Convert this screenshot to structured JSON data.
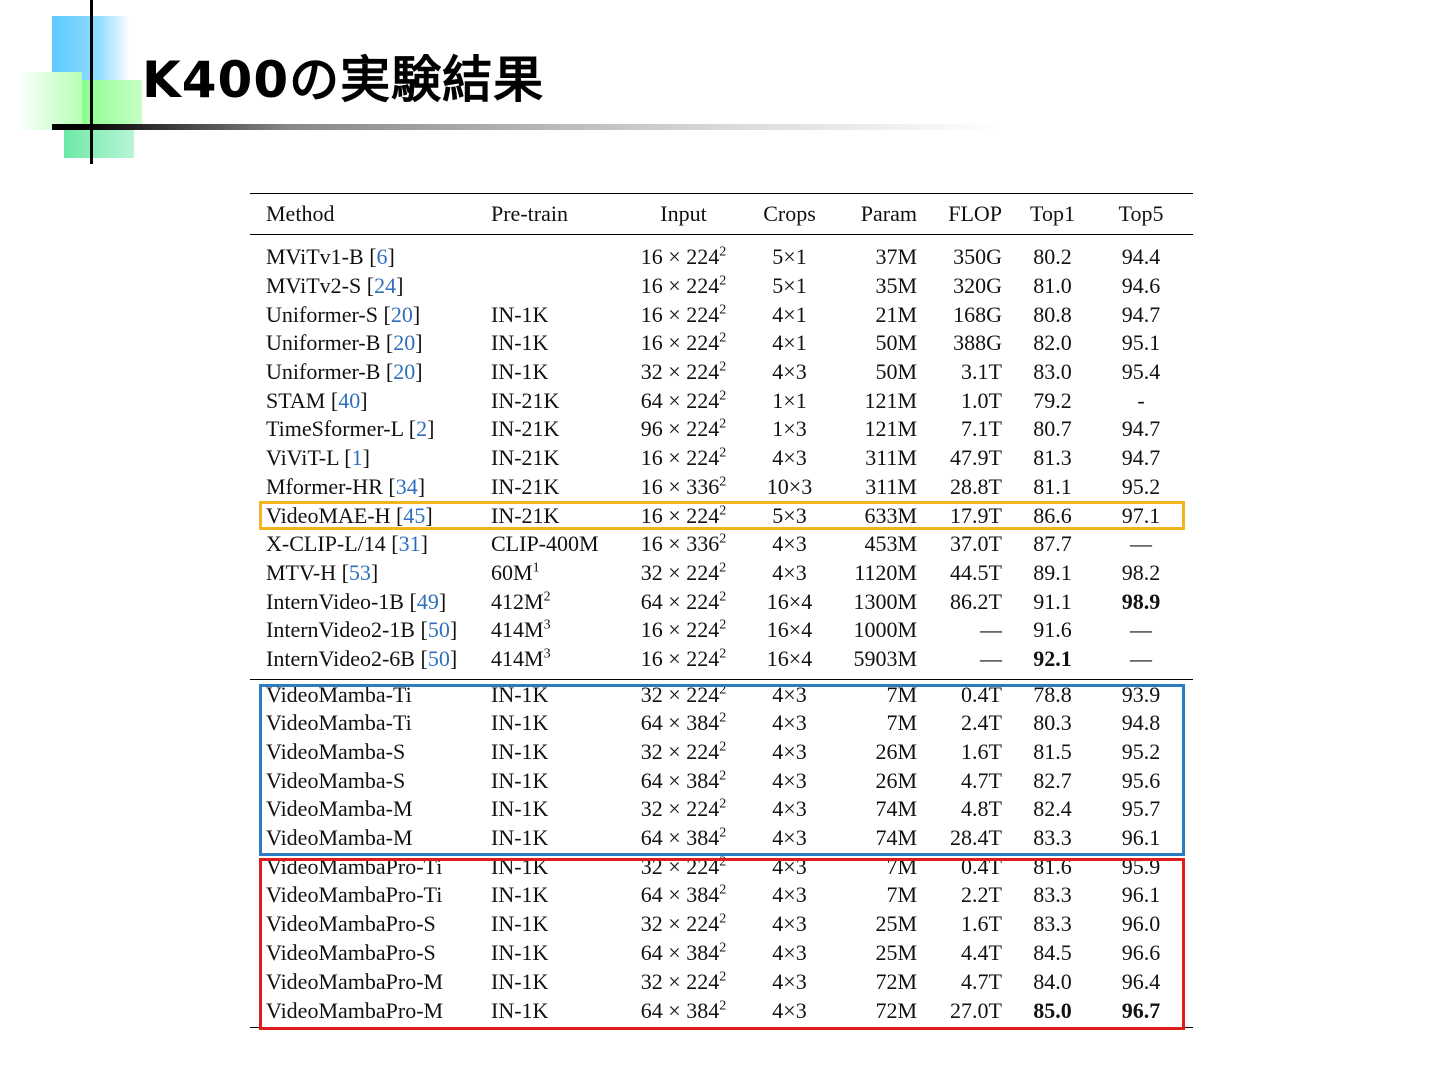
{
  "slide": {
    "title": "K400の実験結果"
  },
  "colors": {
    "highlight_yellow": "#f5b320",
    "highlight_blue": "#2b7cc0",
    "highlight_red": "#e01b1b",
    "ref_blue": "#2f6fbd"
  },
  "table": {
    "headers": {
      "method": "Method",
      "pretrain": "Pre-train",
      "input": "Input",
      "crops": "Crops",
      "param": "Param",
      "flop": "FLOP",
      "top1": "Top1",
      "top5": "Top5"
    },
    "rows": [
      {
        "name": "MViTv1-B",
        "ref": "6",
        "pretrain": "",
        "pt_sup": "",
        "frames": "16",
        "res": "224",
        "crops": "5×1",
        "param": "37M",
        "flop": "350G",
        "top1": "80.2",
        "top5": "94.4"
      },
      {
        "name": "MViTv2-S",
        "ref": "24",
        "pretrain": "",
        "pt_sup": "",
        "frames": "16",
        "res": "224",
        "crops": "5×1",
        "param": "35M",
        "flop": "320G",
        "top1": "81.0",
        "top5": "94.6"
      },
      {
        "name": "Uniformer-S",
        "ref": "20",
        "pretrain": "IN-1K",
        "pt_sup": "",
        "frames": "16",
        "res": "224",
        "crops": "4×1",
        "param": "21M",
        "flop": "168G",
        "top1": "80.8",
        "top5": "94.7"
      },
      {
        "name": "Uniformer-B",
        "ref": "20",
        "pretrain": "IN-1K",
        "pt_sup": "",
        "frames": "16",
        "res": "224",
        "crops": "4×1",
        "param": "50M",
        "flop": "388G",
        "top1": "82.0",
        "top5": "95.1"
      },
      {
        "name": "Uniformer-B",
        "ref": "20",
        "pretrain": "IN-1K",
        "pt_sup": "",
        "frames": "32",
        "res": "224",
        "crops": "4×3",
        "param": "50M",
        "flop": "3.1T",
        "top1": "83.0",
        "top5": "95.4"
      },
      {
        "name": "STAM",
        "ref": "40",
        "pretrain": "IN-21K",
        "pt_sup": "",
        "frames": "64",
        "res": "224",
        "crops": "1×1",
        "param": "121M",
        "flop": "1.0T",
        "top1": "79.2",
        "top5": "-"
      },
      {
        "name": "TimeSformer-L",
        "ref": "2",
        "pretrain": "IN-21K",
        "pt_sup": "",
        "frames": "96",
        "res": "224",
        "crops": "1×3",
        "param": "121M",
        "flop": "7.1T",
        "top1": "80.7",
        "top5": "94.7"
      },
      {
        "name": "ViViT-L",
        "ref": "1",
        "pretrain": "IN-21K",
        "pt_sup": "",
        "frames": "16",
        "res": "224",
        "crops": "4×3",
        "param": "311M",
        "flop": "47.9T",
        "top1": "81.3",
        "top5": "94.7"
      },
      {
        "name": "Mformer-HR",
        "ref": "34",
        "pretrain": "IN-21K",
        "pt_sup": "",
        "frames": "16",
        "res": "336",
        "crops": "10×3",
        "param": "311M",
        "flop": "28.8T",
        "top1": "81.1",
        "top5": "95.2"
      },
      {
        "name": "VideoMAE-H",
        "ref": "45",
        "pretrain": "IN-21K",
        "pt_sup": "",
        "frames": "16",
        "res": "224",
        "crops": "5×3",
        "param": "633M",
        "flop": "17.9T",
        "top1": "86.6",
        "top5": "97.1"
      },
      {
        "name": "X-CLIP-L/14",
        "ref": "31",
        "pretrain": "CLIP-400M",
        "pt_sup": "",
        "frames": "16",
        "res": "336",
        "crops": "4×3",
        "param": "453M",
        "flop": "37.0T",
        "top1": "87.7",
        "top5": "—"
      },
      {
        "name": "MTV-H",
        "ref": "53",
        "pretrain": "60M",
        "pt_sup": "1",
        "frames": "32",
        "res": "224",
        "crops": "4×3",
        "param": "1120M",
        "flop": "44.5T",
        "top1": "89.1",
        "top5": "98.2"
      },
      {
        "name": "InternVideo-1B",
        "ref": "49",
        "pretrain": "412M",
        "pt_sup": "2",
        "frames": "64",
        "res": "224",
        "crops": "16×4",
        "param": "1300M",
        "flop": "86.2T",
        "top1": "91.1",
        "top5": "98.9"
      },
      {
        "name": "InternVideo2-1B",
        "ref": "50",
        "pretrain": "414M",
        "pt_sup": "3",
        "frames": "16",
        "res": "224",
        "crops": "16×4",
        "param": "1000M",
        "flop": "—",
        "top1": "91.6",
        "top5": "—"
      },
      {
        "name": "InternVideo2-6B",
        "ref": "50",
        "pretrain": "414M",
        "pt_sup": "3",
        "frames": "16",
        "res": "224",
        "crops": "16×4",
        "param": "5903M",
        "flop": "—",
        "top1": "92.1",
        "top5": "—"
      },
      {
        "name": "VideoMamba-Ti",
        "ref": "",
        "pretrain": "IN-1K",
        "pt_sup": "",
        "frames": "32",
        "res": "224",
        "crops": "4×3",
        "param": "7M",
        "flop": "0.4T",
        "top1": "78.8",
        "top5": "93.9"
      },
      {
        "name": "VideoMamba-Ti",
        "ref": "",
        "pretrain": "IN-1K",
        "pt_sup": "",
        "frames": "64",
        "res": "384",
        "crops": "4×3",
        "param": "7M",
        "flop": "2.4T",
        "top1": "80.3",
        "top5": "94.8"
      },
      {
        "name": "VideoMamba-S",
        "ref": "",
        "pretrain": "IN-1K",
        "pt_sup": "",
        "frames": "32",
        "res": "224",
        "crops": "4×3",
        "param": "26M",
        "flop": "1.6T",
        "top1": "81.5",
        "top5": "95.2"
      },
      {
        "name": "VideoMamba-S",
        "ref": "",
        "pretrain": "IN-1K",
        "pt_sup": "",
        "frames": "64",
        "res": "384",
        "crops": "4×3",
        "param": "26M",
        "flop": "4.7T",
        "top1": "82.7",
        "top5": "95.6"
      },
      {
        "name": "VideoMamba-M",
        "ref": "",
        "pretrain": "IN-1K",
        "pt_sup": "",
        "frames": "32",
        "res": "224",
        "crops": "4×3",
        "param": "74M",
        "flop": "4.8T",
        "top1": "82.4",
        "top5": "95.7"
      },
      {
        "name": "VideoMamba-M",
        "ref": "",
        "pretrain": "IN-1K",
        "pt_sup": "",
        "frames": "64",
        "res": "384",
        "crops": "4×3",
        "param": "74M",
        "flop": "28.4T",
        "top1": "83.3",
        "top5": "96.1"
      },
      {
        "name": "VideoMambaPro-Ti",
        "ref": "",
        "pretrain": "IN-1K",
        "pt_sup": "",
        "frames": "32",
        "res": "224",
        "crops": "4×3",
        "param": "7M",
        "flop": "0.4T",
        "top1": "81.6",
        "top5": "95.9"
      },
      {
        "name": "VideoMambaPro-Ti",
        "ref": "",
        "pretrain": "IN-1K",
        "pt_sup": "",
        "frames": "64",
        "res": "384",
        "crops": "4×3",
        "param": "7M",
        "flop": "2.2T",
        "top1": "83.3",
        "top5": "96.1"
      },
      {
        "name": "VideoMambaPro-S",
        "ref": "",
        "pretrain": "IN-1K",
        "pt_sup": "",
        "frames": "32",
        "res": "224",
        "crops": "4×3",
        "param": "25M",
        "flop": "1.6T",
        "top1": "83.3",
        "top5": "96.0"
      },
      {
        "name": "VideoMambaPro-S",
        "ref": "",
        "pretrain": "IN-1K",
        "pt_sup": "",
        "frames": "64",
        "res": "384",
        "crops": "4×3",
        "param": "25M",
        "flop": "4.4T",
        "top1": "84.5",
        "top5": "96.6"
      },
      {
        "name": "VideoMambaPro-M",
        "ref": "",
        "pretrain": "IN-1K",
        "pt_sup": "",
        "frames": "32",
        "res": "224",
        "crops": "4×3",
        "param": "72M",
        "flop": "4.7T",
        "top1": "84.0",
        "top5": "96.4"
      },
      {
        "name": "VideoMambaPro-M",
        "ref": "",
        "pretrain": "IN-1K",
        "pt_sup": "",
        "frames": "64",
        "res": "384",
        "crops": "4×3",
        "param": "72M",
        "flop": "27.0T",
        "top1": "85.0",
        "top5": "96.7"
      }
    ]
  }
}
